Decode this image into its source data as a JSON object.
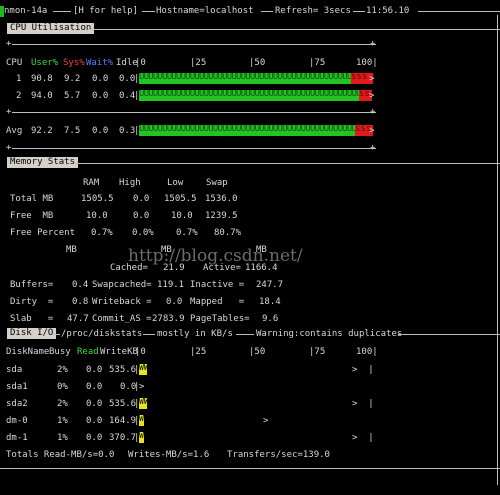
{
  "header": {
    "app": "nmon-14a",
    "help": "[H for help]",
    "hostname": "Hostname=localhost",
    "refresh": "Refresh= 3secs",
    "time": "11:56.10"
  },
  "cpu": {
    "section_title": "CPU Utilisation",
    "col_cpu": "CPU",
    "col_user": "User%",
    "col_sys": "Sys%",
    "col_wait": "Wait%",
    "col_idle": "Idle",
    "scale": [
      "|0",
      "|25",
      "|50",
      "|75",
      "100|"
    ],
    "rows": [
      {
        "cpu": "1",
        "user": "90.8",
        "sys": "9.2",
        "wait": "0.0",
        "idle": "0.0",
        "user_pct": 90.8,
        "sys_pct": 9.2
      },
      {
        "cpu": "2",
        "user": "94.0",
        "sys": "5.7",
        "wait": "0.0",
        "idle": "0.4",
        "user_pct": 94.0,
        "sys_pct": 5.7
      }
    ],
    "avg": {
      "label": "Avg",
      "user": "92.2",
      "sys": "7.5",
      "wait": "0.0",
      "idle": "0.3",
      "user_pct": 92.2,
      "sys_pct": 7.5
    },
    "bar_user_text": "UUUUUUUUUUUUUUUUUUUUUUUUUUUUUUUUUUUUUUUUUUUUUUUUUUUUUUUUUUUUUUUUUUUUUUUUUUUUUUUUUUUUUUUUU",
    "bar_sys_text": "sss",
    "bar_end": ">"
  },
  "memory": {
    "section_title": "Memory Stats",
    "headers": [
      "RAM",
      "High",
      "Low",
      "Swap"
    ],
    "rows": [
      {
        "label": "Total MB",
        "ram": "1505.5",
        "high": "0.0",
        "low": "1505.5",
        "swap": "1536.0"
      },
      {
        "label": "Free  MB",
        "ram": "10.0",
        "high": "0.0",
        "low": "10.0",
        "swap": "1239.5"
      },
      {
        "label": "Free Percent",
        "ram": "0.7%",
        "high": "0.0%",
        "low": "0.7%",
        "swap": "80.7%"
      }
    ],
    "mb_headers": [
      "MB",
      "MB",
      "MB"
    ],
    "stats": [
      {
        "l1": "",
        "v1": "",
        "l2": "Cached=",
        "v2": "21.9",
        "l3": "Active=",
        "v3": "1166.4"
      },
      {
        "l1": "Buffers=",
        "v1": "0.4",
        "l2": "Swapcached=",
        "v2": "119.1",
        "l3": "Inactive =",
        "v3": "247.7"
      },
      {
        "l1": "Dirty  =",
        "v1": "0.8",
        "l2": "Writeback =",
        "v2": "0.0",
        "l3": "Mapped   =",
        "v3": "18.4"
      },
      {
        "l1": "Slab   =",
        "v1": "47.7",
        "l2": "Commit_AS =",
        "v2": "2783.9",
        "l3": "PageTables=",
        "v3": "9.6"
      }
    ]
  },
  "disk": {
    "section_title": "Disk I/O",
    "header_path": "/proc/diskstats",
    "header_units": "mostly in KB/s",
    "header_warning": "Warning:contains duplicates",
    "col_name": "DiskName",
    "col_busy": "Busy",
    "col_read": "Read",
    "col_write": "WriteKB",
    "scale": [
      "|0",
      "|25",
      "|50",
      "|75",
      "100|"
    ],
    "rows": [
      {
        "name": "sda",
        "busy": "2%",
        "read": "0.0",
        "write": "535.6",
        "bar": "WW",
        "bar_pct": 2,
        "tail": ">  |"
      },
      {
        "name": "sda1",
        "busy": "0%",
        "read": "0.0",
        "write": "0.0",
        "bar": "",
        "bar_pct": 0,
        "tail": ">"
      },
      {
        "name": "sda2",
        "busy": "2%",
        "read": "0.0",
        "write": "535.6",
        "bar": "WW",
        "bar_pct": 2,
        "tail": ">  |"
      },
      {
        "name": "dm-0",
        "busy": "1%",
        "read": "0.0",
        "write": "164.9",
        "bar": "W",
        "bar_pct": 1,
        "tail": ">"
      },
      {
        "name": "dm-1",
        "busy": "1%",
        "read": "0.0",
        "write": "370.7",
        "bar": "W",
        "bar_pct": 1,
        "tail": ">  |"
      }
    ],
    "totals": {
      "read": "Totals Read-MB/s=0.0",
      "write": "Writes-MB/s=1.6",
      "transfers": "Transfers/sec=139.0"
    }
  },
  "watermark": "http://blog.csdn.net/"
}
